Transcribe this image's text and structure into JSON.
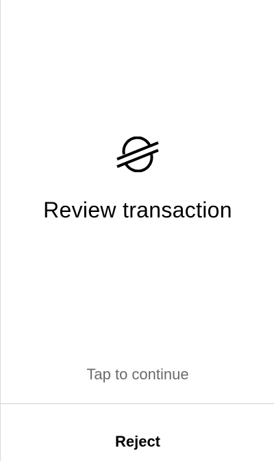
{
  "app": {
    "logo_icon": "stellar-logo-icon"
  },
  "main": {
    "title": "Review transaction",
    "tap_hint": "Tap to continue"
  },
  "footer": {
    "reject_label": "Reject"
  },
  "colors": {
    "background": "#ffffff",
    "text_primary": "#000000",
    "text_secondary": "#6a6a6a",
    "divider": "#cfcfcf"
  }
}
